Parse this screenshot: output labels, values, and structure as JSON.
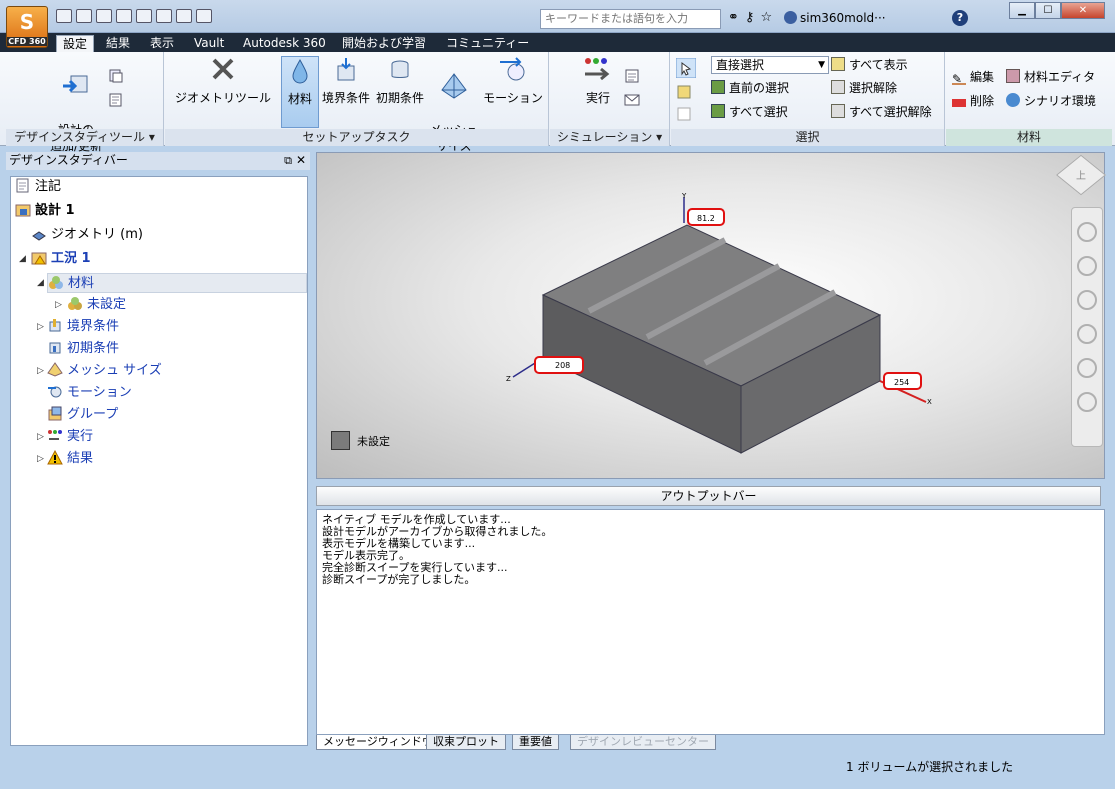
{
  "app": {
    "logo_label": "CFD 360",
    "user": "sim360mold···"
  },
  "search": {
    "placeholder": "キーワードまたは語句を入力"
  },
  "tabs": [
    "設定",
    "結果",
    "表示",
    "Vault",
    "Autodesk 360",
    "開始および学習",
    "コミュニティー"
  ],
  "ribbon": {
    "design_study_tools": {
      "title": "デザインスタディツール",
      "add_update": "設計の\n追加/更新"
    },
    "setup_tasks": {
      "title": "セットアップタスク",
      "geometry_tools": "ジオメトリツール",
      "material": "材料",
      "boundary": "境界条件",
      "initial": "初期条件",
      "mesh": "メッシュ\nサイズ",
      "motion": "モーション"
    },
    "simulation": {
      "title": "シミュレーション",
      "run": "実行"
    },
    "selection": {
      "title": "選択",
      "direct_select": "直接選択",
      "previous_select": "直前の選択",
      "select_all": "すべて選択",
      "show_all": "すべて表示",
      "deselect": "選択解除",
      "deselect_all": "すべて選択解除"
    },
    "materials": {
      "title": "材料",
      "edit": "編集",
      "delete": "削除",
      "material_editor": "材料エディタ",
      "scenario_env": "シナリオ環境"
    }
  },
  "browser": {
    "title": "デザインスタディバー",
    "items": {
      "notes": "注記",
      "design": "設計 1",
      "geometry": "ジオメトリ (m)",
      "scenario": "工況 1",
      "material": "材料",
      "unset": "未設定",
      "boundary": "境界条件",
      "initial": "初期条件",
      "mesh": "メッシュ サイズ",
      "motion": "モーション",
      "group": "グループ",
      "run": "実行",
      "results": "結果"
    }
  },
  "viewport": {
    "dims": {
      "y": "81.2",
      "z": "208",
      "x": "254"
    },
    "axes": {
      "x": "X",
      "y": "Y",
      "z": "Z"
    },
    "legend_label": "未設定",
    "viewcube_label": "上"
  },
  "output": {
    "title": "アウトプットバー",
    "lines": [
      "ネイティブ モデルを作成しています...",
      "設計モデルがアーカイブから取得されました。",
      "表示モデルを構築しています...",
      "モデル表示完了。",
      "完全診断スイープを実行しています...",
      "診断スイープが完了しました。"
    ],
    "tabs": [
      "メッセージウィンドウ",
      "収束プロット",
      "重要値",
      "デザインレビューセンター"
    ]
  },
  "status": "1 ボリュームが選択されました",
  "colors": {
    "title_bg": "#b9d1ea",
    "tab_bg": "#1e2a39",
    "highlight_red": "#e01010",
    "model_gray": "#7b7b7b"
  }
}
